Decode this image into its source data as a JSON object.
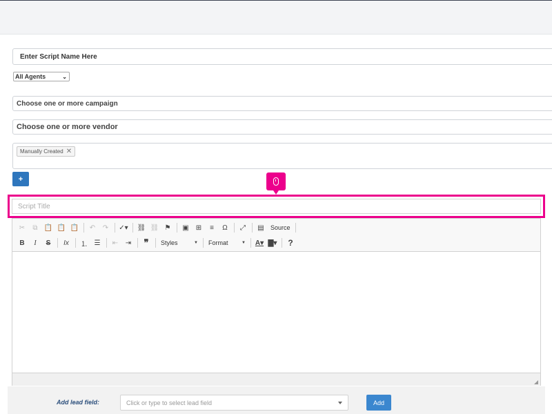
{
  "form": {
    "script_name_placeholder": "Enter Script Name Here",
    "agents_selected": "All Agents",
    "campaign_placeholder": "Choose one or more campaign",
    "vendor_placeholder": "Choose one or more vendor",
    "tags": [
      {
        "label": "Manually Created",
        "remove": "✕"
      }
    ],
    "add_button": "+"
  },
  "editor": {
    "title_placeholder": "Script Title",
    "source_label": "Source",
    "styles_label": "Styles",
    "format_label": "Format",
    "help_label": "?"
  },
  "lead": {
    "label": "Add lead field:",
    "placeholder": "Click or type to select lead field",
    "add_button": "Add"
  },
  "colors": {
    "highlight": "#ec008c",
    "primary_button": "#2e76bd"
  }
}
